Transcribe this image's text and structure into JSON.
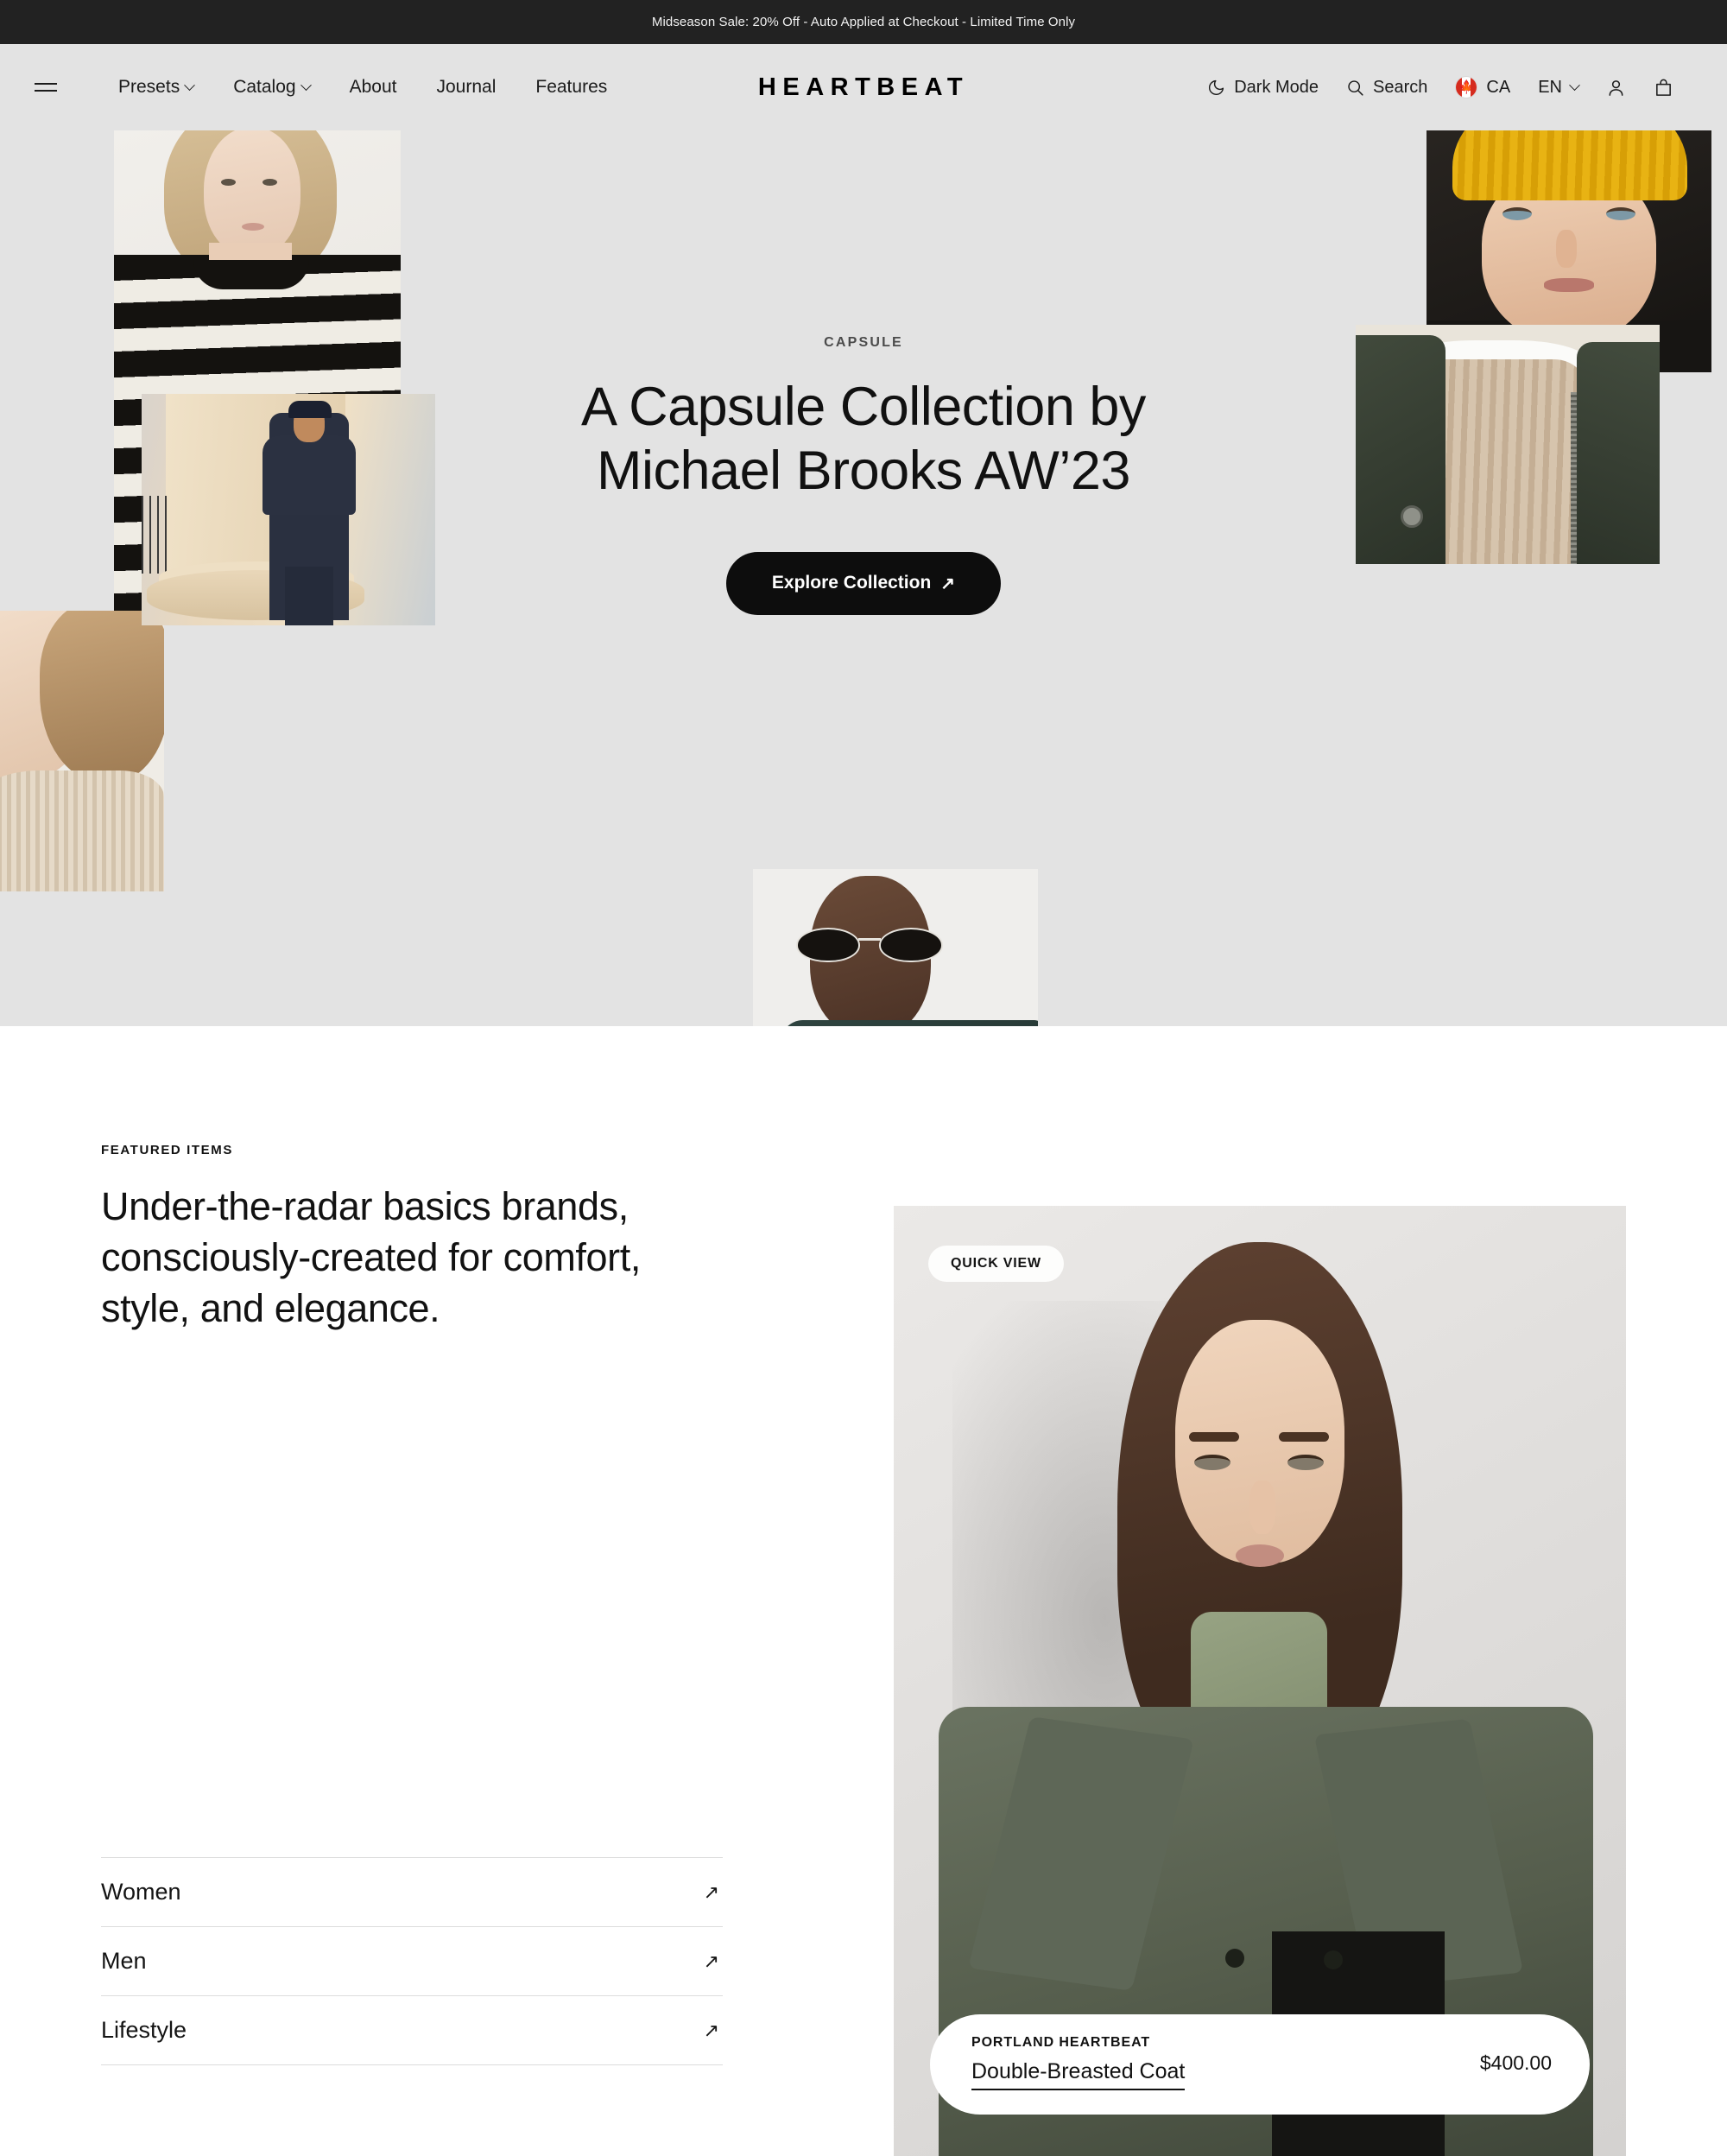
{
  "announcement": {
    "text": "Midseason Sale: 20% Off - Auto Applied at Checkout - Limited Time Only"
  },
  "header": {
    "menu_icon": "hamburger-icon",
    "logo": "HEARTBEAT",
    "nav": [
      {
        "label": "Presets",
        "has_dropdown": true
      },
      {
        "label": "Catalog",
        "has_dropdown": true
      },
      {
        "label": "About",
        "has_dropdown": false
      },
      {
        "label": "Journal",
        "has_dropdown": false
      },
      {
        "label": "Features",
        "has_dropdown": false
      }
    ],
    "dark_mode": {
      "label": "Dark Mode",
      "icon": "moon-icon"
    },
    "search": {
      "label": "Search",
      "icon": "search-icon"
    },
    "country": {
      "label": "CA",
      "icon": "flag-canada-icon"
    },
    "language": {
      "label": "EN",
      "icon": "chevron-down-icon"
    },
    "account_icon": "user-icon",
    "cart_icon": "shopping-bag-icon"
  },
  "hero": {
    "eyebrow": "CAPSULE",
    "title_line1": "A Capsule Collection by",
    "title_line2": "Michael Brooks AW’23",
    "cta_label": "Explore Collection",
    "cta_arrow": "↗",
    "background_color": "#e3e3e3"
  },
  "featured": {
    "eyebrow": "FEATURED ITEMS",
    "heading_line1": "Under-the-radar basics brands,",
    "heading_line2": "consciously-created for comfort,",
    "heading_line3": "style, and elegance.",
    "categories": [
      {
        "label": "Women",
        "arrow": "↗"
      },
      {
        "label": "Men",
        "arrow": "↗"
      },
      {
        "label": "Lifestyle",
        "arrow": "↗"
      }
    ]
  },
  "product": {
    "quick_view_label": "QUICK VIEW",
    "brand": "PORTLAND HEARTBEAT",
    "name": "Double-Breasted Coat",
    "price": "$400.00"
  },
  "colors": {
    "announcement_bg": "#222222",
    "hero_bg": "#e3e3e3",
    "cta_bg": "#0d0d0d",
    "text_primary": "#111111",
    "flag_red": "#d52b1e"
  }
}
